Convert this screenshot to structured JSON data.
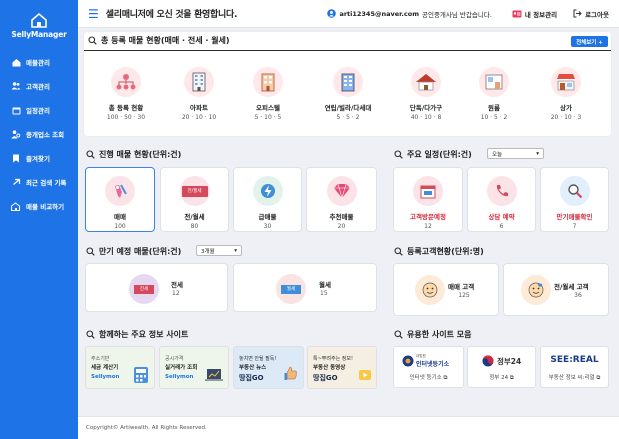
{
  "sidebar": {
    "brand": "SellyManager",
    "items": [
      {
        "label": "매물관리",
        "icon": "home-icon"
      },
      {
        "label": "고객관리",
        "icon": "users-icon"
      },
      {
        "label": "일정관리",
        "icon": "calendar-icon"
      },
      {
        "label": "중개업소 조회",
        "icon": "agent-search-icon"
      },
      {
        "label": "즐겨찾기",
        "icon": "bookmark-icon"
      },
      {
        "label": "최근 검색 기록",
        "icon": "history-icon"
      },
      {
        "label": "매물 비교하기",
        "icon": "compare-icon"
      }
    ]
  },
  "header": {
    "title": "셀리매니저에 오신 것을 환영합니다.",
    "email": "arti12345@naver.com",
    "greeting": "공인중개사님 반갑습니다.",
    "my_info": "내 정보관리",
    "logout": "로그아웃"
  },
  "total": {
    "title": "총 등록 매물 현황(매매 · 전세 · 월세)",
    "view_all": "전체보기 +",
    "items": [
      {
        "label": "총 등록 현황",
        "value": "100 · 50 · 30"
      },
      {
        "label": "아파트",
        "value": "20 · 10 · 10"
      },
      {
        "label": "오피스텔",
        "value": "5 · 10 · 5"
      },
      {
        "label": "연립/빌라/다세대",
        "value": "5 · 5 · 2"
      },
      {
        "label": "단독/다가구",
        "value": "40 · 10 · 8"
      },
      {
        "label": "원룸",
        "value": "10 · 5 · 2"
      },
      {
        "label": "상가",
        "value": "20 · 10 · 3"
      }
    ]
  },
  "progress": {
    "title": "진행 매물 현황(단위:건)",
    "items": [
      {
        "label": "매매",
        "value": "100",
        "badge": ""
      },
      {
        "label": "전/월세",
        "value": "80",
        "badge": "전/월세"
      },
      {
        "label": "급매물",
        "value": "30",
        "badge": ""
      },
      {
        "label": "추천매물",
        "value": "20",
        "badge": ""
      }
    ]
  },
  "schedule": {
    "title": "주요 일정(단위:건)",
    "select": "오늘",
    "items": [
      {
        "label": "고객방문예정",
        "value": "12"
      },
      {
        "label": "상담 예약",
        "value": "6"
      },
      {
        "label": "만기매물확인",
        "value": "7"
      }
    ]
  },
  "expire": {
    "title": "만기 예정 매물(단위:건)",
    "select": "3개월",
    "items": [
      {
        "label": "전세",
        "value": "12",
        "badge": "전세"
      },
      {
        "label": "월세",
        "value": "15",
        "badge": "월세"
      }
    ]
  },
  "customers": {
    "title": "등록고객현황(단위:명)",
    "items": [
      {
        "label": "매매 고객",
        "value": "125"
      },
      {
        "label": "전/월세 고객",
        "value": "36"
      }
    ]
  },
  "partners": {
    "title": "함께하는 주요 정보 사이트",
    "banners": [
      {
        "l1": "주소기반",
        "l2": "세금 계산기",
        "brand": "Sellymon"
      },
      {
        "l1": "공시가격",
        "l2": "실거래가 조회",
        "brand": "Sellymon"
      },
      {
        "l1": "놓치면 안될 필독!",
        "l2": "부동산 뉴스",
        "brand": "땅집GO"
      },
      {
        "l1": "톡~뿌려주는 정보!",
        "l2": "부동산 동영상",
        "brand": "땅집GO"
      }
    ]
  },
  "links": {
    "title": "유용한 사이트 모음",
    "items": [
      {
        "label": "인터넷 등기소",
        "logo": "대법원",
        "logo2": "인터넷등기소"
      },
      {
        "label": "정부 24",
        "logo": "정부24",
        "logo2": ""
      },
      {
        "label": "부동산 정보 씨:리얼",
        "logo": "SEE:REAL",
        "logo2": ""
      }
    ]
  },
  "footer": {
    "copyright": "Copyright© Artiwealth. All Rights Reserved."
  },
  "colors": {
    "accent": "#1e74e6"
  }
}
